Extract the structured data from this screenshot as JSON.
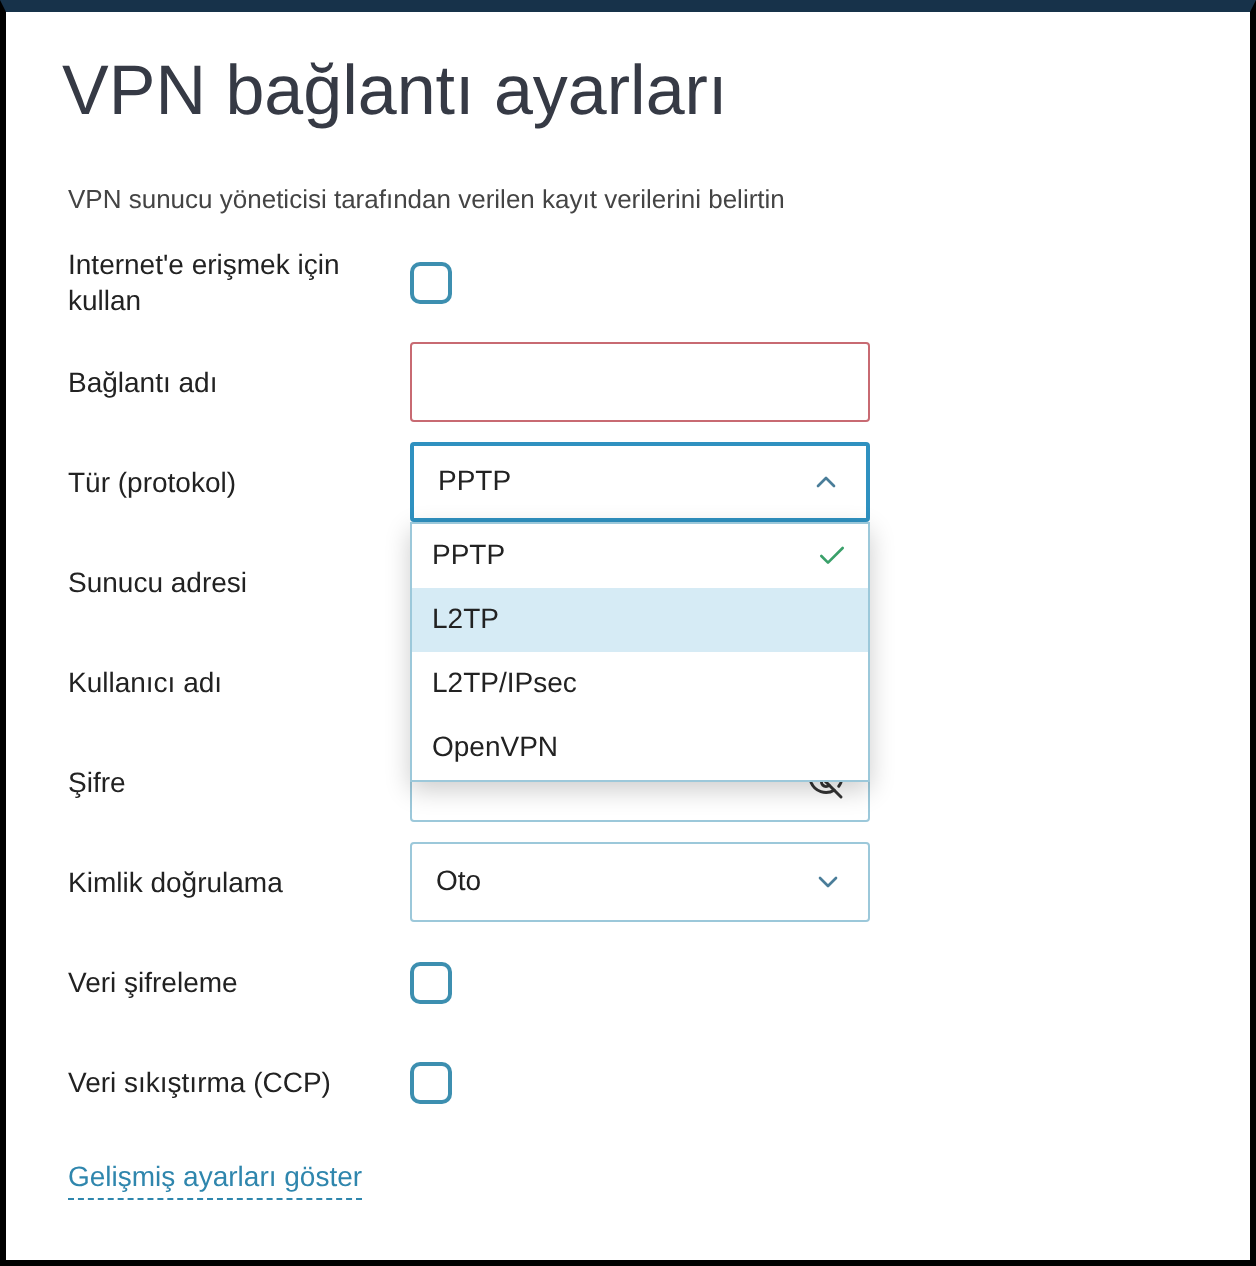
{
  "title": "VPN bağlantı ayarları",
  "description": "VPN sunucu yöneticisi tarafından verilen kayıt verilerini belirtin",
  "fields": [
    {
      "kind": "checkbox",
      "label": "Internet'e erişmek için kullan",
      "checked": false
    },
    {
      "kind": "text",
      "label": "Bağlantı adı",
      "invalid": true
    },
    {
      "kind": "select",
      "label": "Tür (protokol)",
      "value": "PPTP",
      "expanded": true,
      "options": [
        {
          "label": "PPTP",
          "selected": true,
          "highlighted": false
        },
        {
          "label": "L2TP",
          "selected": false,
          "highlighted": true
        },
        {
          "label": "L2TP/IPsec",
          "selected": false,
          "highlighted": false
        },
        {
          "label": "OpenVPN",
          "selected": false,
          "highlighted": false
        }
      ]
    },
    {
      "kind": "covered",
      "label": "Sunucu adresi"
    },
    {
      "kind": "covered",
      "label": "Kullanıcı adı"
    },
    {
      "kind": "password",
      "label": "Şifre"
    },
    {
      "kind": "select",
      "label": "Kimlik doğrulama",
      "value": "Oto",
      "expanded": false
    },
    {
      "kind": "checkbox",
      "label": "Veri şifreleme",
      "checked": false
    },
    {
      "kind": "checkbox",
      "label": "Veri sıkıştırma (CCP)",
      "checked": false
    }
  ],
  "link": "Gelişmiş ayarları göster"
}
